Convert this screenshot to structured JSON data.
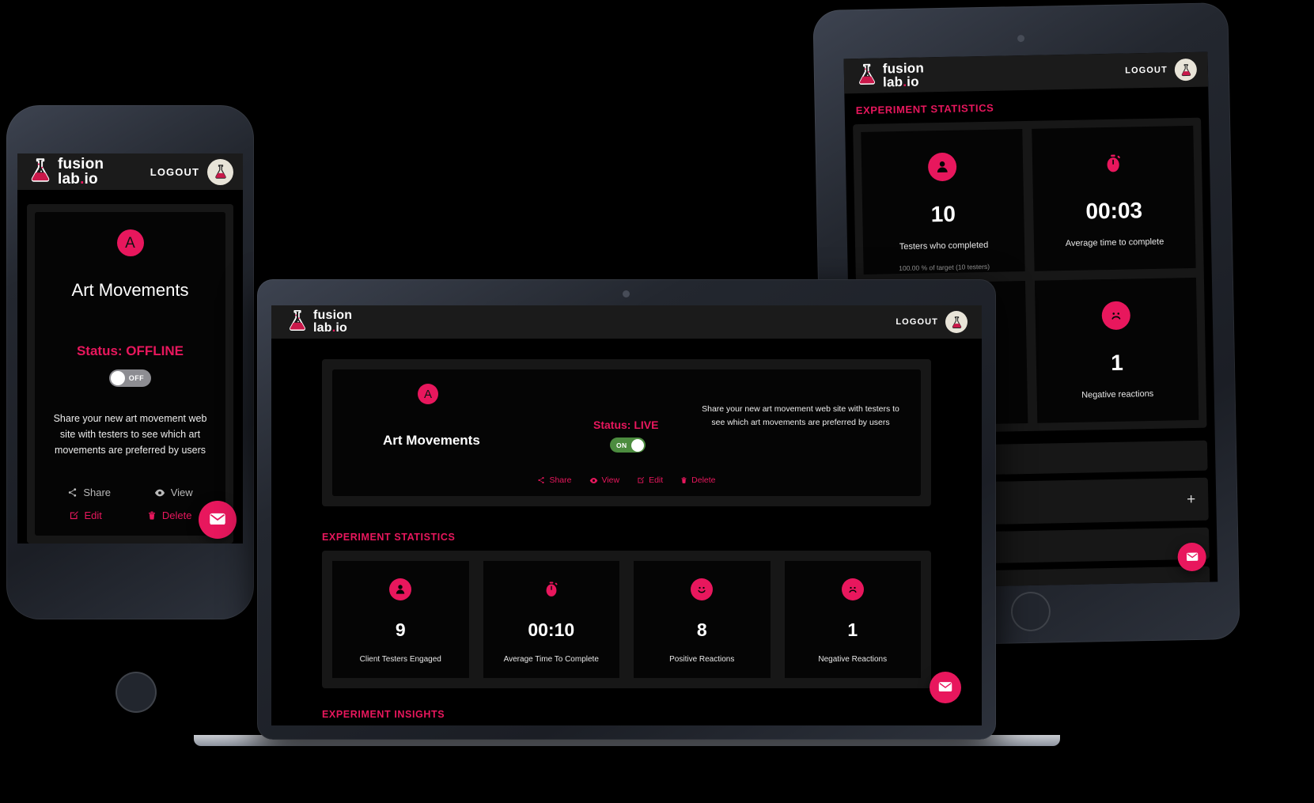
{
  "brand": {
    "name_line1": "fusion",
    "name_line2": "lab",
    "name_dot": ".",
    "name_tld": "io",
    "logo_icon": "flask-icon",
    "accent_color": "#e8175d",
    "toggle_on_color": "#4c8c3f",
    "toggle_off_color": "#8d8d92"
  },
  "header": {
    "logout_label": "LOGOUT",
    "avatar_icon": "flask-avatar-icon"
  },
  "phone": {
    "experiment": {
      "badge_letter": "A",
      "title": "Art Movements",
      "status_label": "Status: OFFLINE",
      "toggle_state": "OFF",
      "toggle_label": "OFF",
      "description": "Share your new art movement web site with testers to see which art movements are preferred by users",
      "actions": [
        {
          "label": "Share",
          "icon": "share-icon",
          "tone": "grey"
        },
        {
          "label": "View",
          "icon": "eye-icon",
          "tone": "grey"
        },
        {
          "label": "Edit",
          "icon": "edit-icon",
          "tone": "pink"
        },
        {
          "label": "Delete",
          "icon": "trash-icon",
          "tone": "pink"
        }
      ]
    },
    "chat_widget_icon": "chat-bubble-icon"
  },
  "laptop": {
    "experiment": {
      "badge_letter": "A",
      "title": "Art Movements",
      "status_label": "Status: LIVE",
      "toggle_state": "ON",
      "toggle_label": "ON",
      "description": "Share your new art movement web site with testers to see which art movements are preferred by users",
      "actions": [
        {
          "label": "Share",
          "icon": "share-icon",
          "tone": "pink"
        },
        {
          "label": "View",
          "icon": "eye-icon",
          "tone": "pink"
        },
        {
          "label": "Edit",
          "icon": "edit-icon",
          "tone": "pink"
        },
        {
          "label": "Delete",
          "icon": "trash-icon",
          "tone": "pink"
        }
      ]
    },
    "statistics_heading": "EXPERIMENT STATISTICS",
    "insights_heading": "EXPERIMENT INSIGHTS",
    "stats": [
      {
        "icon": "person-icon",
        "value": "9",
        "label": "Client Testers Engaged"
      },
      {
        "icon": "stopwatch-icon",
        "value": "00:10",
        "label": "Average Time To Complete"
      },
      {
        "icon": "smiley-happy-icon",
        "value": "8",
        "label": "Positive Reactions"
      },
      {
        "icon": "smiley-sad-icon",
        "value": "1",
        "label": "Negative Reactions"
      }
    ],
    "chat_widget_icon": "chat-bubble-icon"
  },
  "tablet": {
    "statistics_heading": "EXPERIMENT STATISTICS",
    "stats": [
      {
        "icon": "person-icon",
        "value": "10",
        "label": "Testers who completed",
        "sub": "100.00 % of target (10 testers)"
      },
      {
        "icon": "stopwatch-icon",
        "value": "00:03",
        "label": "Average time to complete",
        "sub": ""
      },
      {
        "icon": "smiley-happy-icon",
        "value": "",
        "label": "",
        "sub": ""
      },
      {
        "icon": "smiley-sad-icon",
        "value": "1",
        "label": "Negative reactions",
        "sub": ""
      }
    ],
    "add_button_label": "+",
    "chat_widget_icon": "chat-bubble-icon"
  }
}
